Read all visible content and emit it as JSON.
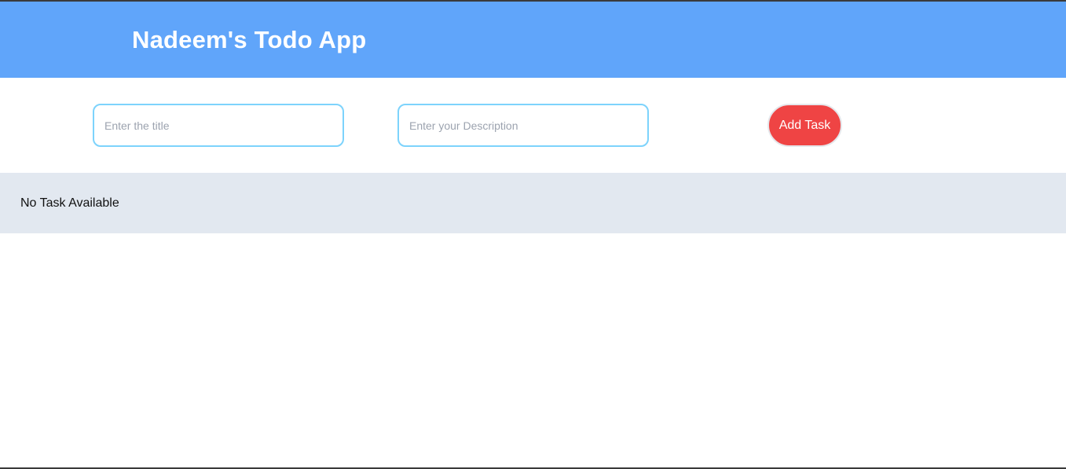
{
  "app": {
    "title": "Nadeem's Todo App"
  },
  "form": {
    "title_placeholder": "Enter the title",
    "title_value": "",
    "description_placeholder": "Enter your Description",
    "description_value": "",
    "add_button_label": "Add Task"
  },
  "tasks": {
    "empty_message": "No Task Available",
    "items": []
  },
  "colors": {
    "header_bg": "#60a5fa",
    "input_border": "#7dd3fc",
    "add_button_bg": "#ef4444",
    "task_panel_bg": "#e2e8f0"
  }
}
